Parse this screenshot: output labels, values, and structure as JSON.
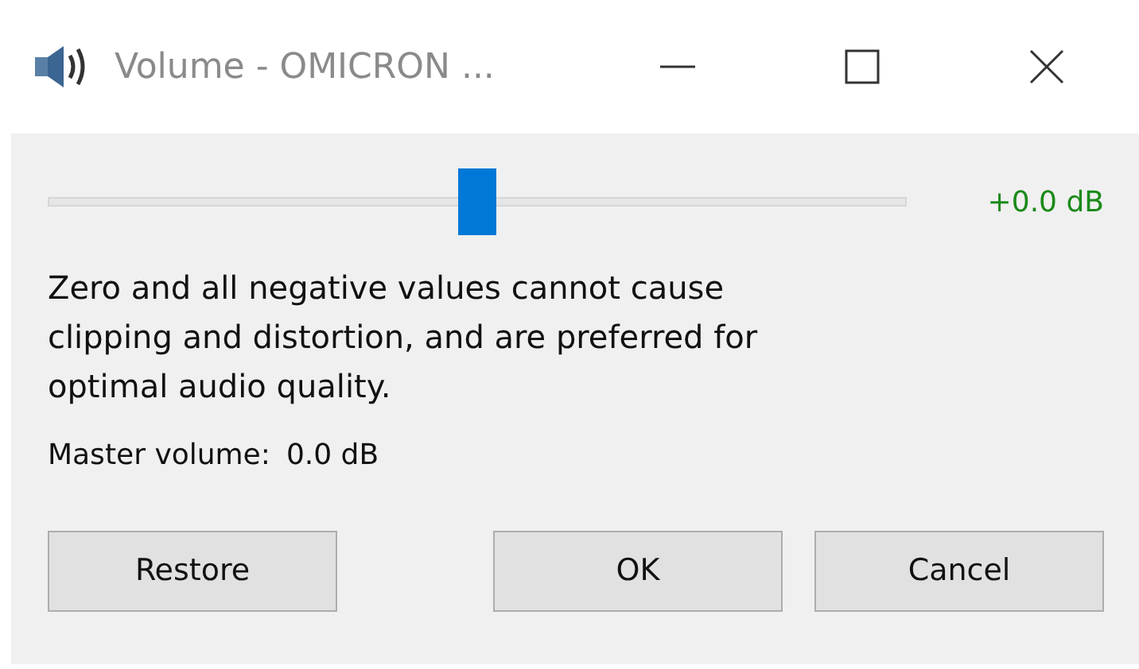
{
  "window": {
    "title": "Volume - OMICRON ..."
  },
  "slider": {
    "level": 0.5,
    "reading": "+0.0 dB"
  },
  "note": "Zero and all negative values cannot cause clipping and distortion, and are preferred for optimal audio quality.",
  "master_volume": {
    "label": "Master volume:",
    "value": "0.0 dB"
  },
  "buttons": [
    {
      "label": "Restore",
      "kind": "left"
    },
    {
      "label": "OK",
      "kind": "right"
    },
    {
      "label": "Cancel",
      "kind": "right"
    }
  ]
}
